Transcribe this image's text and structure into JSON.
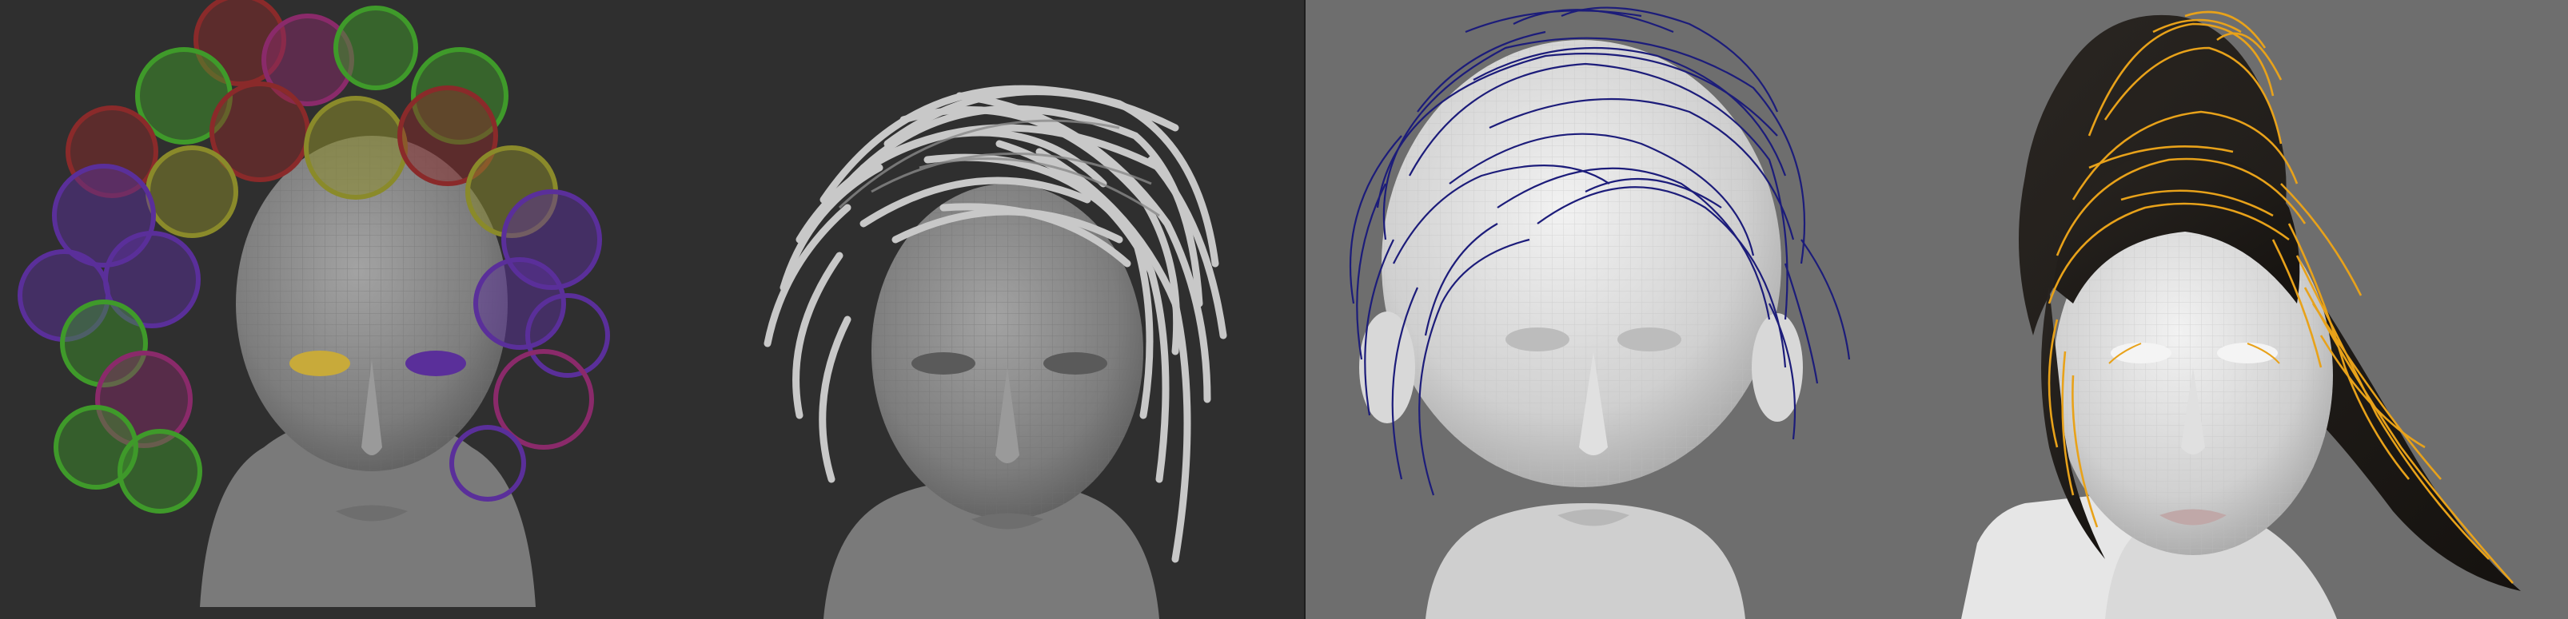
{
  "viewports": [
    {
      "id": "left",
      "background": "#2f2f2f",
      "heads": [
        "tube-curl-clusters",
        "hair-card-strips"
      ]
    },
    {
      "id": "right",
      "background": "#6e6e6e",
      "heads": [
        "guide-curves-blue",
        "rendered-hair-with-orange-guides"
      ]
    }
  ],
  "colors": {
    "head_dark": "#8a8a8a",
    "head_light": "#d4d4d4",
    "curl_green": "#3f9a2a",
    "curl_purple": "#5a2f9a",
    "curl_red": "#8a2a2a",
    "curl_olive": "#8a8a2a",
    "curl_magenta": "#8a2a6a",
    "strip_grey": "#c8c8c8",
    "guide_blue": "#1c1c7a",
    "guide_orange": "#e8a21a",
    "hair_dark": "#1e1b18"
  }
}
